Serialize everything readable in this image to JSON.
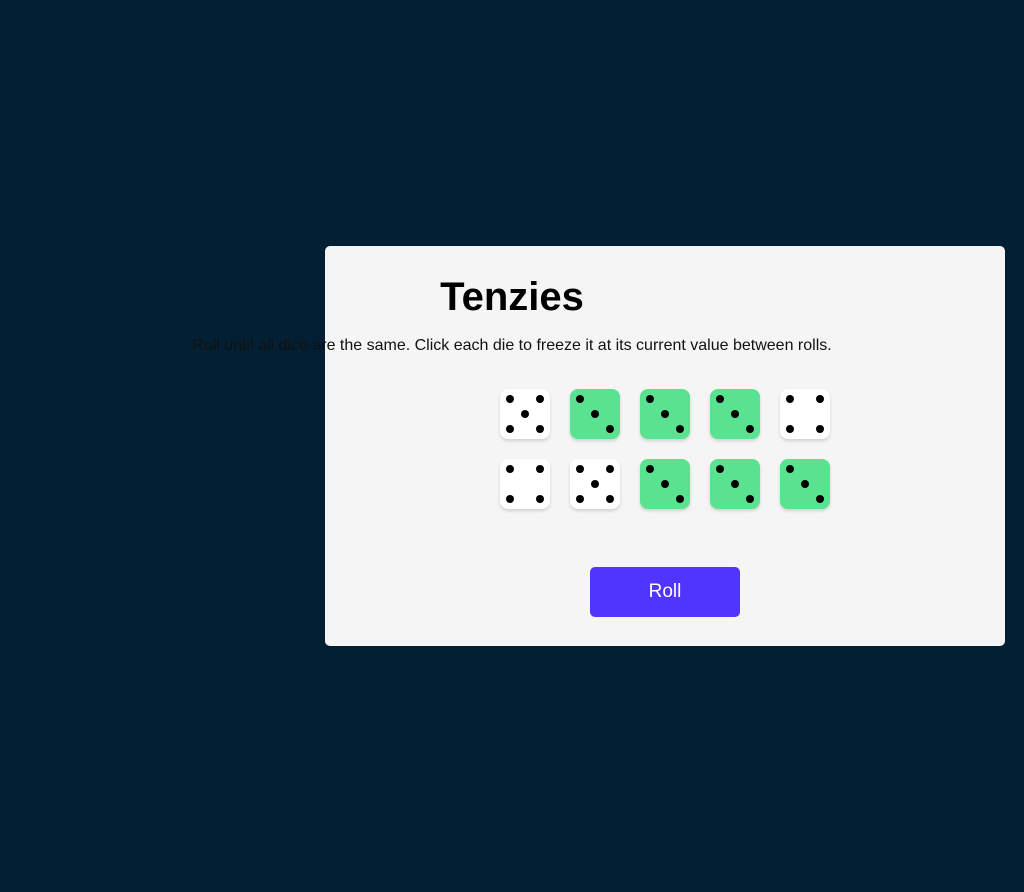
{
  "game": {
    "title": "Tenzies",
    "instructions": "Roll until all dice are the same. Click each die to freeze it at its current value between rolls.",
    "roll_label": "Roll"
  },
  "dice": [
    {
      "value": 5,
      "held": false
    },
    {
      "value": 3,
      "held": true
    },
    {
      "value": 3,
      "held": true
    },
    {
      "value": 3,
      "held": true
    },
    {
      "value": 4,
      "held": false
    },
    {
      "value": 4,
      "held": false
    },
    {
      "value": 5,
      "held": false
    },
    {
      "value": 3,
      "held": true
    },
    {
      "value": 3,
      "held": true
    },
    {
      "value": 3,
      "held": true
    }
  ],
  "colors": {
    "background": "#031f33",
    "board": "#f5f5f5",
    "die": "#ffffff",
    "held_die": "#59e391",
    "pip": "#000000",
    "button": "#5035ff"
  }
}
